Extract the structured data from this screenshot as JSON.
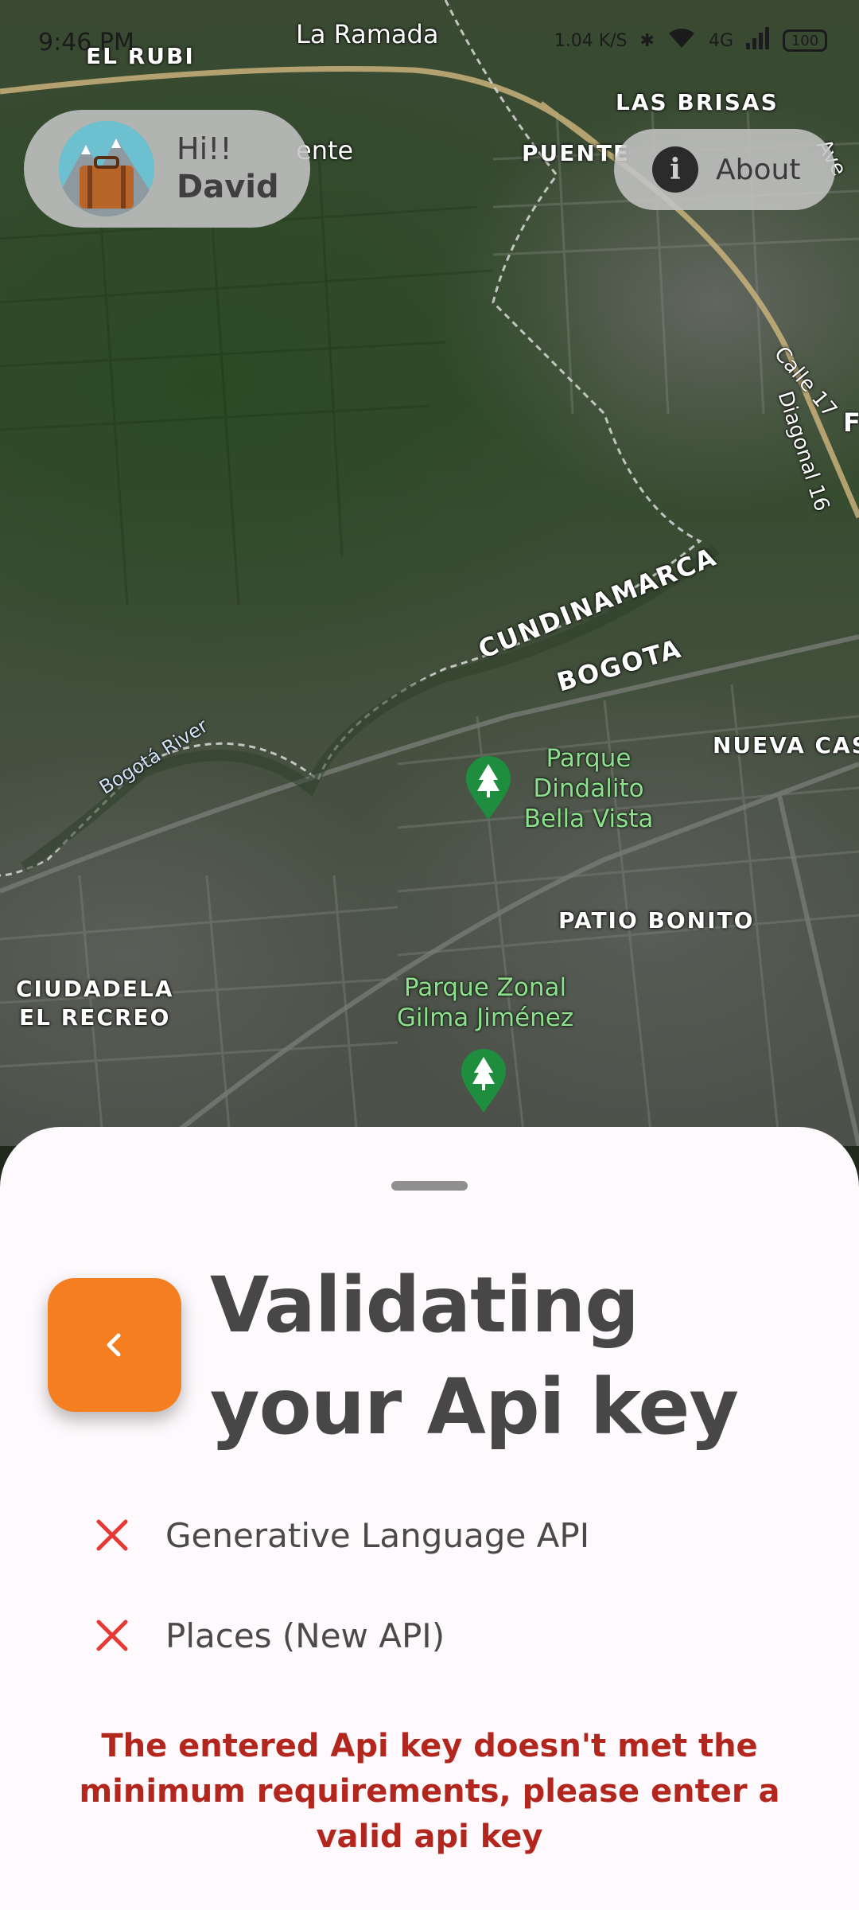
{
  "status_bar": {
    "time": "9:46 PM",
    "network_speed": "1.04 K/S",
    "network_type": "4G",
    "battery": "100"
  },
  "map": {
    "labels": {
      "la_ramada": "La Ramada",
      "el_rubi": "EL RUBI",
      "las_brisas": "LAS BRISAS",
      "puente": "PUENTE",
      "ente": "ente",
      "calle_17": "Calle 17",
      "diagonal_16": "Diagonal 16",
      "ave": "Ave",
      "f": "F",
      "cundinamarca": "CUNDINAMARCA",
      "bogota": "BOGOTA",
      "bogota_river": "Bogotá River",
      "nueva_cas": "NUEVA CAS",
      "patio_bonito": "PATIO BONITO",
      "ciudadela": "CIUDADELA",
      "el_recreo": "EL RECREO"
    },
    "parks": {
      "dindalito": "Parque\nDindalito\nBella Vista",
      "gilma": "Parque Zonal\nGilma Jiménez"
    }
  },
  "user": {
    "greeting": "Hi!!",
    "name": "David"
  },
  "about_button": {
    "label": "About"
  },
  "sheet": {
    "title": "Validating your Api key",
    "checks": [
      {
        "label": "Generative Language API",
        "status": "failed"
      },
      {
        "label": "Places (New API)",
        "status": "failed"
      }
    ],
    "error_message": "The entered Api key doesn't met the minimum requirements, please enter a valid api key"
  },
  "colors": {
    "accent": "#f47e20",
    "error": "#b3261e",
    "fail_icon": "#e53935"
  }
}
